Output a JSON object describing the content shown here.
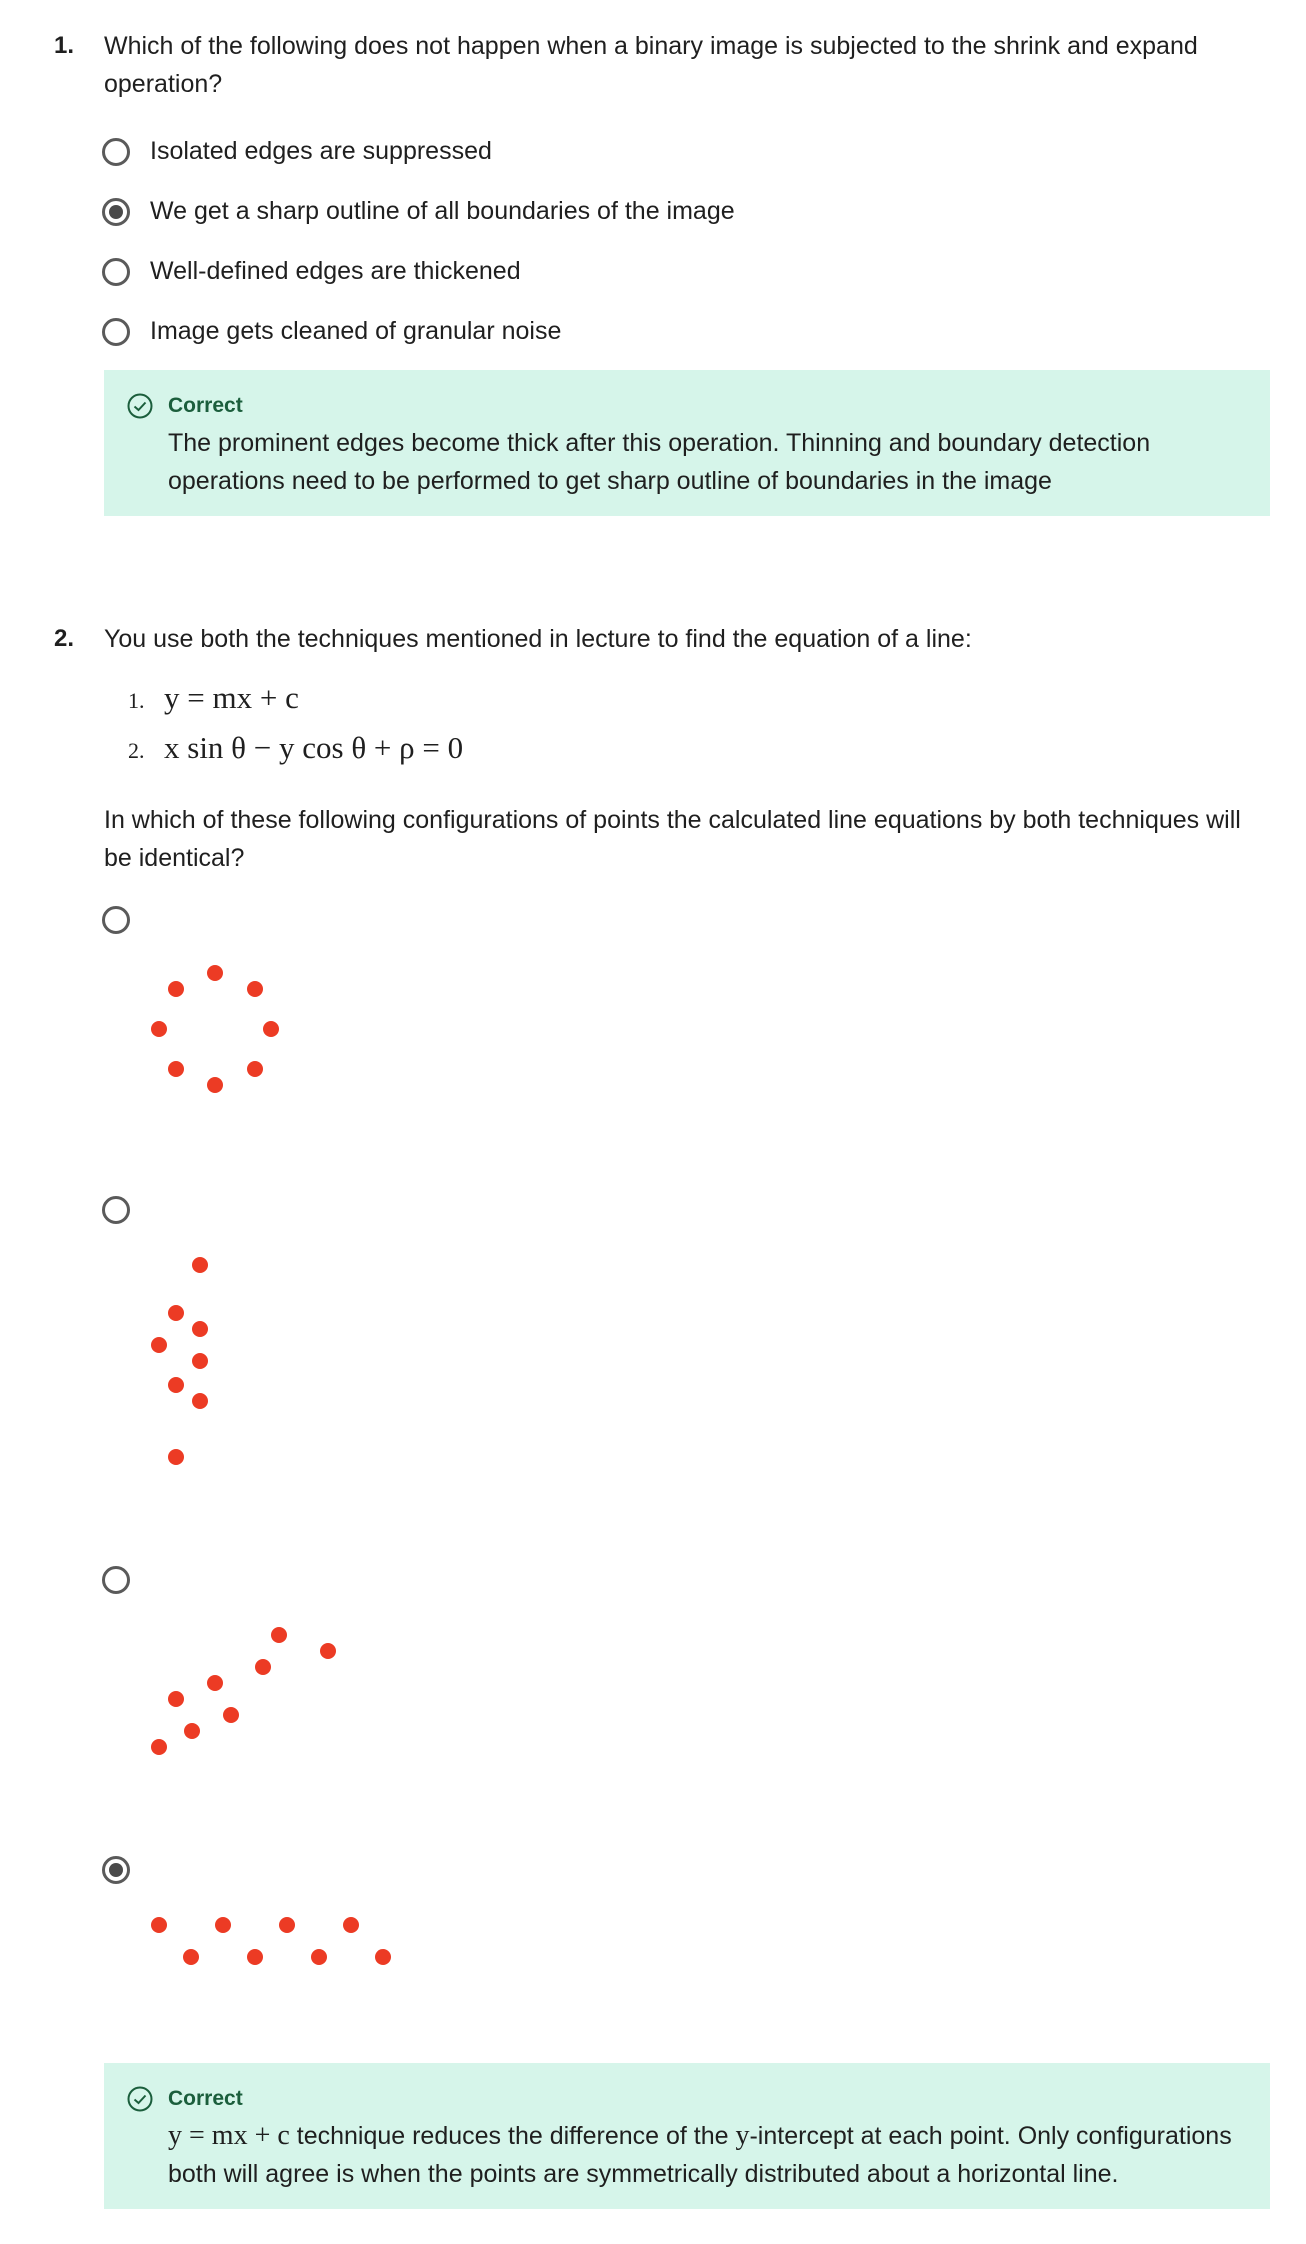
{
  "questions": [
    {
      "number": "1.",
      "prompt": "Which of the following does not happen when a binary image is subjected to the shrink and expand operation?",
      "options": [
        {
          "label": "Isolated edges are suppressed",
          "selected": false
        },
        {
          "label": "We get a sharp outline of all boundaries of the image",
          "selected": true
        },
        {
          "label": "Well-defined edges are thickened",
          "selected": false
        },
        {
          "label": "Image gets cleaned of granular noise",
          "selected": false
        }
      ],
      "feedback": {
        "title": "Correct",
        "body": "The prominent edges become thick after this operation. Thinning and boundary detection operations need to be performed to get sharp outline of boundaries in the image"
      }
    },
    {
      "number": "2.",
      "prompt": "You use both the techniques mentioned in lecture to find the equation of a line:",
      "equations": [
        {
          "num": "1.",
          "text": "y = mx + c"
        },
        {
          "num": "2.",
          "text": "x sin θ − y cos θ + ρ = 0"
        }
      ],
      "question": "In which of these following configurations of points the calculated line equations by both techniques will be identical?",
      "options": [
        {
          "selected": false,
          "points_label": "circle"
        },
        {
          "selected": false,
          "points_label": "vertical-cluster"
        },
        {
          "selected": false,
          "points_label": "diagonal"
        },
        {
          "selected": true,
          "points_label": "zigzag"
        }
      ],
      "feedback": {
        "title": "Correct",
        "math": "y = mx + c",
        "text_a": " technique reduces the difference of the ",
        "math_var": "y",
        "text_b": "-intercept at each point. Only configurations both will agree is when the points are symmetrically distributed about a horizontal line."
      }
    }
  ],
  "colors": {
    "dot": "#ec3b24",
    "feedback_bg": "#d6f5ea",
    "feedback_title": "#1b5e3c"
  }
}
